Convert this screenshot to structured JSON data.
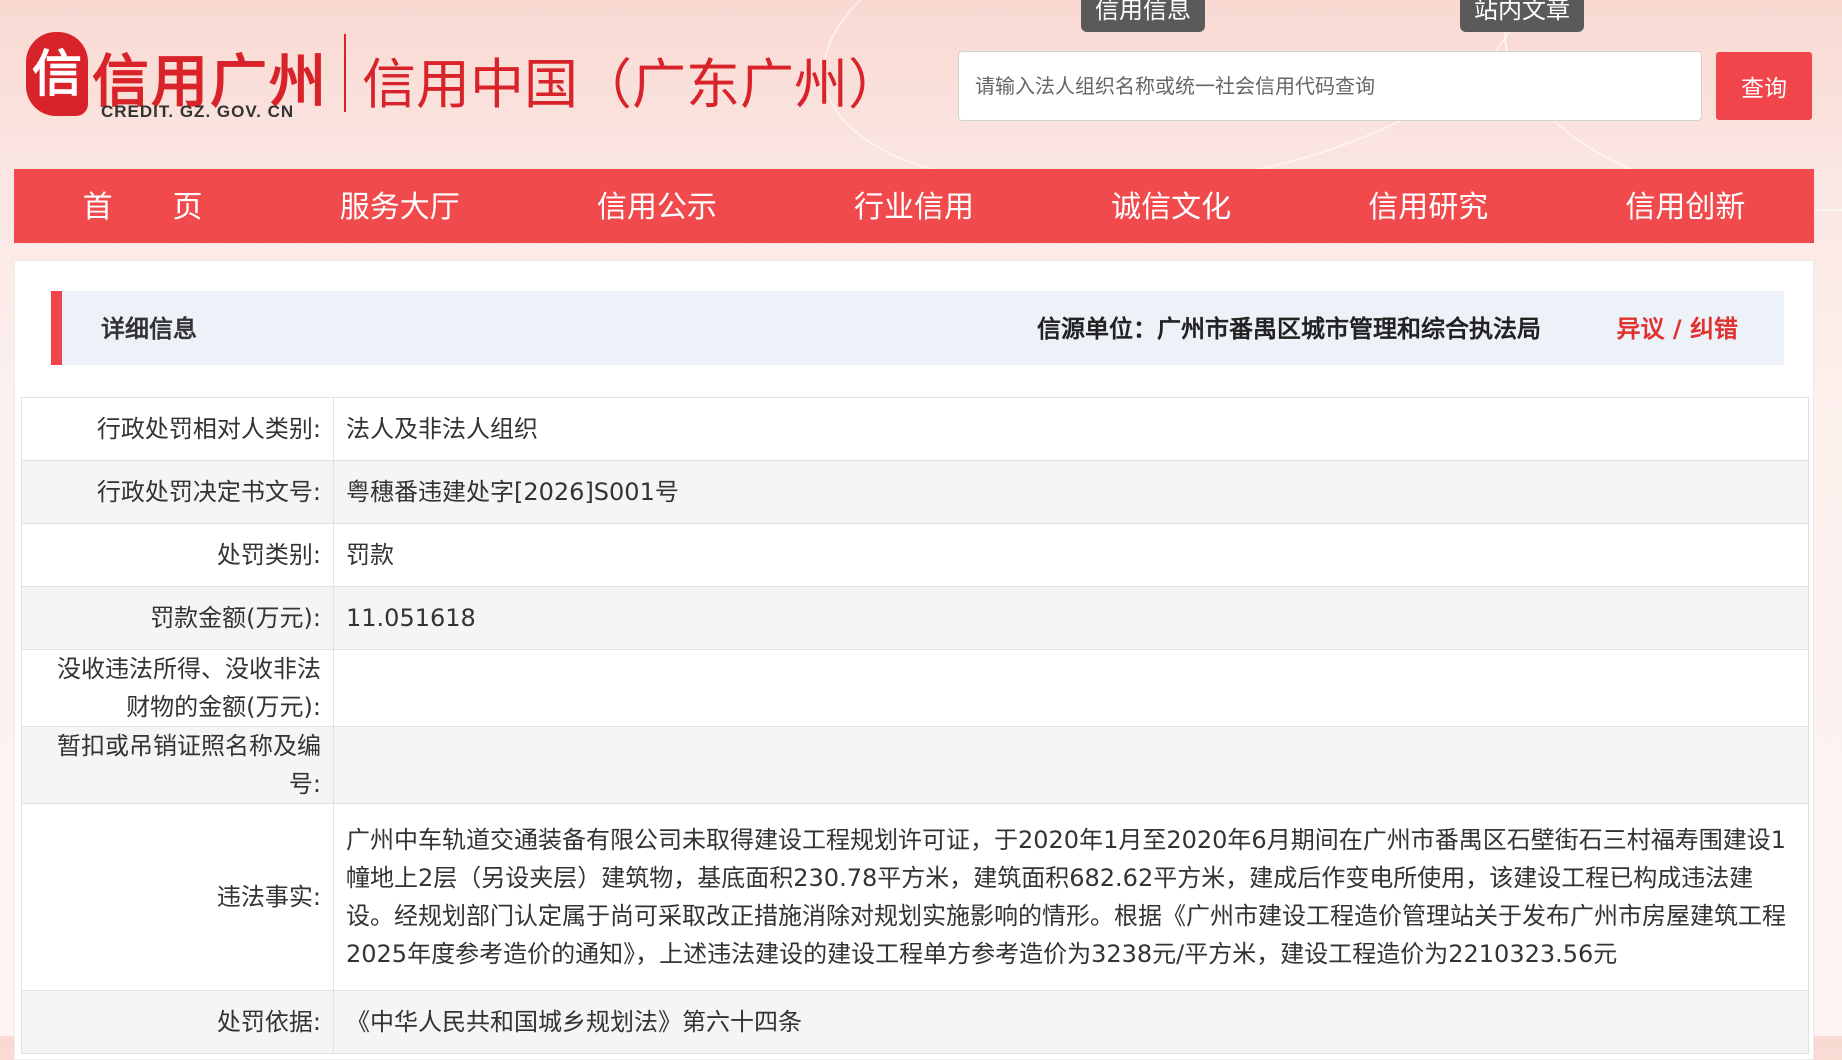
{
  "header": {
    "logo_seal": "信",
    "logo_cn": "信用广州",
    "logo_en": "CREDIT. GZ. GOV. CN",
    "logo_sub": "信用中国（广东广州）",
    "tab_credit_info": "信用信息",
    "tab_site_articles": "站内文章",
    "search_placeholder": "请输入法人组织名称或统一社会信用代码查询",
    "search_button": "查询"
  },
  "nav": {
    "items": [
      "首　　页",
      "服务大厅",
      "信用公示",
      "行业信用",
      "诚信文化",
      "信用研究",
      "信用创新"
    ]
  },
  "detail": {
    "title": "详细信息",
    "source": "信源单位：广州市番禺区城市管理和综合执法局",
    "objection": "异议 / 纠错"
  },
  "rows": [
    {
      "label": "行政处罚相对人类别:",
      "value": "法人及非法人组织"
    },
    {
      "label": "行政处罚决定书文号:",
      "value": "粤穗番违建处字[2026]S001号"
    },
    {
      "label": "处罚类别:",
      "value": "罚款"
    },
    {
      "label": "罚款金额(万元):",
      "value": "11.051618"
    },
    {
      "label": "没收违法所得、没收非法财物的金额(万元):",
      "value": ""
    },
    {
      "label": "暂扣或吊销证照名称及编号:",
      "value": ""
    },
    {
      "label": "违法事实:",
      "value": "广州中车轨道交通装备有限公司未取得建设工程规划许可证，于2020年1月至2020年6月期间在广州市番禺区石壁街石三村福寿围建设1幢地上2层（另设夹层）建筑物，基底面积230.78平方米，建筑面积682.62平方米，建成后作变电所使用，该建设工程已构成违法建设。经规划部门认定属于尚可采取改正措施消除对规划实施影响的情形。根据《广州市建设工程造价管理站关于发布广州市房屋建筑工程2025年度参考造价的通知》，上述违法建设的建设工程单方参考造价为3238元/平方米，建设工程造价为2210323.56元"
    },
    {
      "label": "处罚依据:",
      "value": "《中华人民共和国城乡规划法》第六十四条"
    }
  ],
  "colors": {
    "brand_red": "#f14a4d",
    "nav_red": "#f14a4d",
    "accent": "#e0312f"
  }
}
